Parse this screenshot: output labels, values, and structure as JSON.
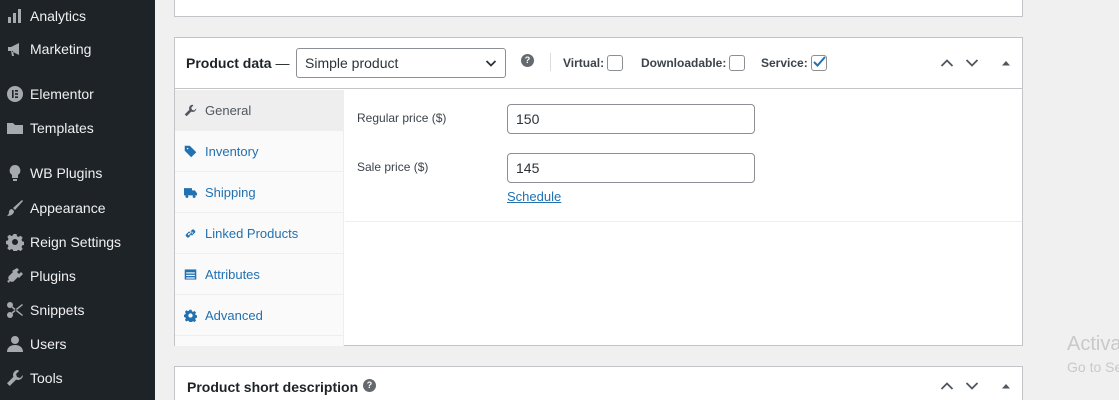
{
  "sidebar": {
    "items": [
      {
        "label": "Analytics",
        "icon": "bar-chart-icon"
      },
      {
        "label": "Marketing",
        "icon": "megaphone-icon"
      },
      {
        "label": "Elementor",
        "icon": "elementor-icon"
      },
      {
        "label": "Templates",
        "icon": "folder-icon"
      },
      {
        "label": "WB Plugins",
        "icon": "lightbulb-icon"
      },
      {
        "label": "Appearance",
        "icon": "paintbrush-icon"
      },
      {
        "label": "Reign Settings",
        "icon": "gear-icon"
      },
      {
        "label": "Plugins",
        "icon": "plug-icon"
      },
      {
        "label": "Snippets",
        "icon": "scissors-icon"
      },
      {
        "label": "Users",
        "icon": "user-icon"
      },
      {
        "label": "Tools",
        "icon": "wrench-icon"
      }
    ]
  },
  "product_data": {
    "title": "Product data",
    "dash": "—",
    "type_selected": "Simple product",
    "options": {
      "virtual": {
        "label": "Virtual:",
        "checked": false
      },
      "downloadable": {
        "label": "Downloadable:",
        "checked": false
      },
      "service": {
        "label": "Service:",
        "checked": true
      }
    },
    "tabs": [
      {
        "label": "General",
        "icon": "wrench-icon",
        "active": true
      },
      {
        "label": "Inventory",
        "icon": "tag-icon",
        "active": false
      },
      {
        "label": "Shipping",
        "icon": "truck-icon",
        "active": false
      },
      {
        "label": "Linked Products",
        "icon": "link-icon",
        "active": false
      },
      {
        "label": "Attributes",
        "icon": "list-icon",
        "active": false
      },
      {
        "label": "Advanced",
        "icon": "gear-icon",
        "active": false
      }
    ],
    "general": {
      "regular_price_label": "Regular price ($)",
      "regular_price_value": "150",
      "sale_price_label": "Sale price ($)",
      "sale_price_value": "145",
      "schedule_link": "Schedule"
    }
  },
  "short_description": {
    "title": "Product short description"
  },
  "watermark": {
    "line1": "Activa",
    "line2": "Go to Se"
  },
  "colors": {
    "sidebar_bg": "#1d2327",
    "link": "#2271b1",
    "page_bg": "#f0f0f1"
  }
}
